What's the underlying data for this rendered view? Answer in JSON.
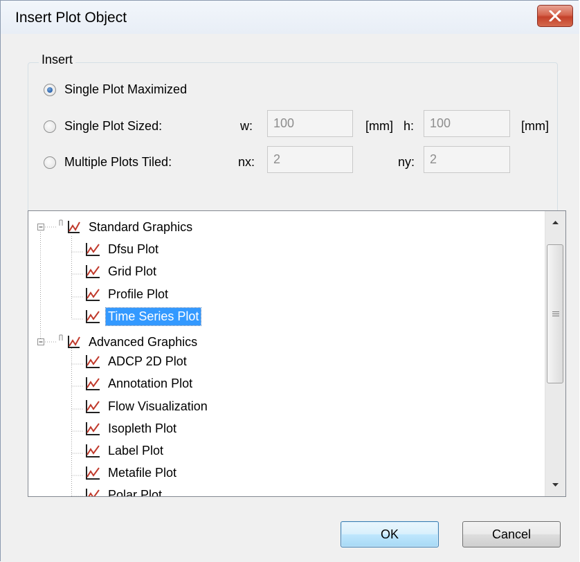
{
  "window": {
    "title": "Insert Plot Object"
  },
  "insert_group": {
    "label": "Insert",
    "options": [
      {
        "label": "Single Plot Maximized",
        "checked": true
      },
      {
        "label": "Single Plot Sized:",
        "checked": false
      },
      {
        "label": "Multiple Plots Tiled:",
        "checked": false
      }
    ],
    "w_label": "w:",
    "w_value": "100",
    "w_unit": "[mm]",
    "h_label": "h:",
    "h_value": "100",
    "h_unit": "[mm]",
    "nx_label": "nx:",
    "nx_value": "2",
    "ny_label": "ny:",
    "ny_value": "2"
  },
  "tree": {
    "groups": [
      {
        "label": "Standard Graphics",
        "items": [
          "Dfsu Plot",
          "Grid Plot",
          "Profile Plot",
          "Time Series Plot"
        ]
      },
      {
        "label": "Advanced Graphics",
        "items": [
          "ADCP 2D Plot",
          "Annotation Plot",
          "Flow Visualization",
          "Isopleth Plot",
          "Label Plot",
          "Metafile Plot",
          "Polar Plot"
        ]
      }
    ],
    "selected": "Time Series Plot"
  },
  "buttons": {
    "ok": "OK",
    "cancel": "Cancel"
  },
  "colors": {
    "selection": "#3399ff",
    "icon_red": "#c0392b"
  }
}
